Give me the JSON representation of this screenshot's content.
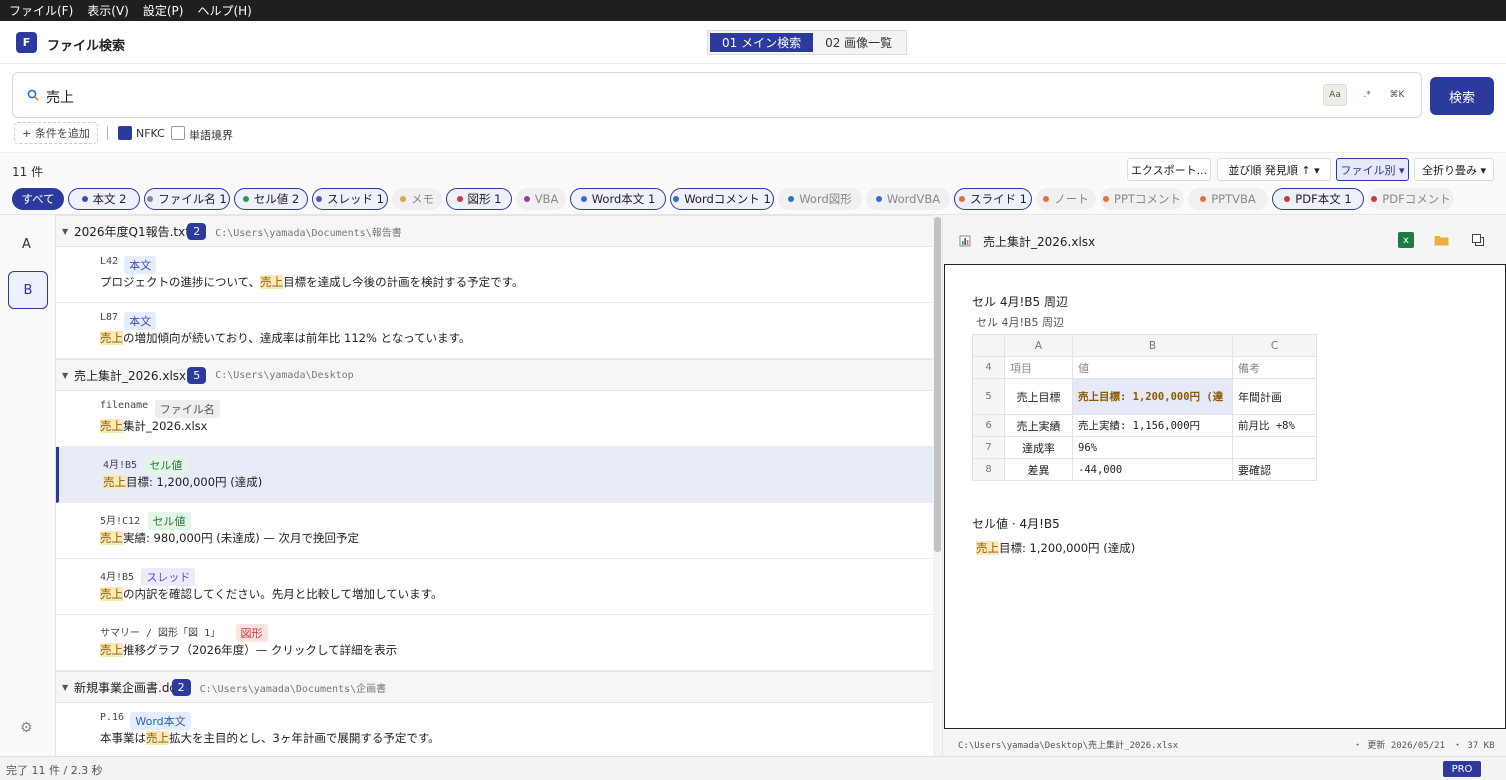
{
  "menu": [
    "ファイル(F)",
    "表示(V)",
    "設定(P)",
    "ヘルプ(H)"
  ],
  "app": {
    "logo_letter": "F",
    "title": "ファイル検索"
  },
  "tabs": [
    {
      "label": "01 メイン検索",
      "active": true
    },
    {
      "label": "02 画像一覧",
      "active": false
    }
  ],
  "search": {
    "value": "売上",
    "opt_case": "Aa",
    "opt_regex": ".*",
    "opt_shortcut": "⌘K",
    "button": "検索",
    "add_condition": "+ 条件を追加",
    "nfkc_label": "NFKC",
    "nfkc_checked": true,
    "word_boundary_label": "単語境界",
    "word_boundary_checked": false
  },
  "toolbar": {
    "count": "11 件",
    "export": "エクスポート...",
    "sort": "並び順  発見順 ↑ ▾",
    "group": "ファイル別 ▾",
    "collapse": "全折り畳み ▾"
  },
  "chips": [
    {
      "label": "すべて",
      "color": "",
      "state": "active"
    },
    {
      "label": "本文 2",
      "color": "#3b4db8",
      "state": "strong"
    },
    {
      "label": "ファイル名 1",
      "color": "#888888",
      "state": "strong"
    },
    {
      "label": "セル値 2",
      "color": "#2e9a46",
      "state": "strong"
    },
    {
      "label": "スレッド 1",
      "color": "#5b4fc7",
      "state": "strong"
    },
    {
      "label": "メモ",
      "color": "#d7a83a",
      "state": "muted"
    },
    {
      "label": "図形 1",
      "color": "#c93a3a",
      "state": "strong"
    },
    {
      "label": "VBA",
      "color": "#a03aa0",
      "state": "muted"
    },
    {
      "label": "Word本文 1",
      "color": "#2c6ed0",
      "state": "strong"
    },
    {
      "label": "Wordコメント 1",
      "color": "#2c6ed0",
      "state": "strong"
    },
    {
      "label": "Word図形",
      "color": "#2c6ed0",
      "state": "muted"
    },
    {
      "label": "WordVBA",
      "color": "#2c6ed0",
      "state": "muted"
    },
    {
      "label": "スライド 1",
      "color": "#e0703a",
      "state": "strong"
    },
    {
      "label": "ノート",
      "color": "#e0703a",
      "state": "muted"
    },
    {
      "label": "PPTコメント",
      "color": "#e0703a",
      "state": "muted"
    },
    {
      "label": "PPTVBA",
      "color": "#e0703a",
      "state": "muted"
    },
    {
      "label": "PDF本文 1",
      "color": "#c93a3a",
      "state": "strong"
    },
    {
      "label": "PDFコメント",
      "color": "#c93a3a",
      "state": "muted"
    }
  ],
  "rail": {
    "a": "A",
    "b": "B"
  },
  "results": [
    {
      "type": "group",
      "name": "2026年度Q1報告.txt",
      "count": "2",
      "path": "C:\\Users\\yamada\\Documents\\報告書"
    },
    {
      "type": "row",
      "loc": "L42",
      "tag": "本文",
      "tag_kind": "body",
      "pre": "プロジェクトの進捗について、",
      "hit": "売上",
      "post": "目標を達成し今後の計画を検討する予定です。"
    },
    {
      "type": "row",
      "loc": "L87",
      "tag": "本文",
      "tag_kind": "body",
      "pre": "",
      "hit": "売上",
      "post": "の増加傾向が続いており、達成率は前年比 112% となっています。"
    },
    {
      "type": "group",
      "name": "売上集計_2026.xlsx",
      "count": "5",
      "path": "C:\\Users\\yamada\\Desktop"
    },
    {
      "type": "row",
      "loc": "filename",
      "tag": "ファイル名",
      "tag_kind": "file",
      "pre": "",
      "hit": "売上",
      "post": "集計_2026.xlsx"
    },
    {
      "type": "row",
      "loc": "4月!B5",
      "tag": "セル値",
      "tag_kind": "cell",
      "pre": "",
      "hit": "売上",
      "post": "目標: 1,200,000円 (達成)",
      "selected": true
    },
    {
      "type": "row",
      "loc": "5月!C12",
      "tag": "セル値",
      "tag_kind": "cell",
      "pre": "",
      "hit": "売上",
      "post": "実績: 980,000円 (未達成) — 次月で挽回予定"
    },
    {
      "type": "row",
      "loc": "4月!B5",
      "tag": "スレッド",
      "tag_kind": "thread",
      "pre": "",
      "hit": "売上",
      "post": "の内訳を確認してください。先月と比較して増加しています。"
    },
    {
      "type": "row",
      "loc": "サマリー / 図形「図 1」",
      "tag": "図形",
      "tag_kind": "shape",
      "pre": "",
      "hit": "売上",
      "post": "推移グラフ（2026年度）— クリックして詳細を表示"
    },
    {
      "type": "group",
      "name": "新規事業企画書.docx",
      "count": "2",
      "path": "C:\\Users\\yamada\\Documents\\企画書"
    },
    {
      "type": "row",
      "loc": "P.16",
      "tag": "Word本文",
      "tag_kind": "word",
      "pre": "本事業は",
      "hit": "売上",
      "post": "拡大を主目的とし、3ヶ年計画で展開する予定です。"
    }
  ],
  "preview": {
    "title": "売上集計_2026.xlsx",
    "cell_title": "セル 4月!B5 周辺",
    "cell_sub": "セル 4月!B5 周辺",
    "columns": [
      "",
      "A",
      "B",
      "C"
    ],
    "rows": [
      {
        "n": "4",
        "a": "項目",
        "b": "値",
        "c": "備考",
        "header": true
      },
      {
        "n": "5",
        "a": "売上目標",
        "b": "売上目標: 1,200,000円 (達",
        "c": "年間計画",
        "hit": true
      },
      {
        "n": "6",
        "a": "売上実績",
        "b": "売上実績: 1,156,000円",
        "c": "前月比 +8%"
      },
      {
        "n": "7",
        "a": "達成率",
        "b": "96%",
        "c": ""
      },
      {
        "n": "8",
        "a": "差異",
        "b": "-44,000",
        "c": "要確認"
      }
    ],
    "cell_desc": "セル値 · 4月!B5",
    "cell_value_hit": "売上",
    "cell_value_rest": "目標: 1,200,000円 (達成)",
    "footer_path": "C:\\Users\\yamada\\Desktop\\売上集計_2026.xlsx",
    "footer_updated": "・ 更新 2026/05/21",
    "footer_size": "・ 37 KB"
  },
  "status": {
    "text": "完了 11 件 / 2.3 秒",
    "badge": "PRO"
  },
  "colors": {
    "accent": "#2c3a9e",
    "highlight": "#fde9b8"
  }
}
